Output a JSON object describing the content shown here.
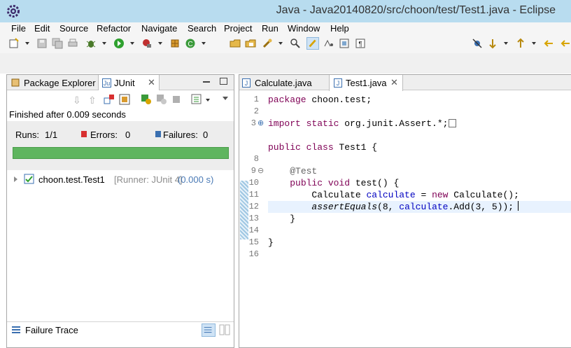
{
  "window": {
    "title": "Java - Java20140820/src/choon/test/Test1.java - Eclipse"
  },
  "menu": [
    "File",
    "Edit",
    "Source",
    "Refactor",
    "Navigate",
    "Search",
    "Project",
    "Run",
    "Window",
    "Help"
  ],
  "left_panel": {
    "tabs": {
      "package_explorer": "Package Explorer",
      "junit": "JUnit"
    },
    "status": "Finished after 0.009 seconds",
    "counters": {
      "runs_label": "Runs:",
      "runs_value": "1/1",
      "errors_label": "Errors:",
      "errors_value": "0",
      "failures_label": "Failures:",
      "failures_value": "0"
    },
    "progress": {
      "fraction": 1.0,
      "color": "#5fb55f"
    },
    "tree": {
      "name": "choon.test.Test1",
      "runner": "[Runner: JUnit 4]",
      "time": "(0.000 s)"
    },
    "failure_trace": "Failure Trace"
  },
  "editor": {
    "tabs": {
      "calculate": "Calculate.java",
      "test1": "Test1.java"
    },
    "line_numbers": [
      "1",
      "2",
      "3",
      "8",
      "9",
      "10",
      "11",
      "12",
      "13",
      "14",
      "15",
      "16"
    ],
    "code": {
      "l1_kw": "package",
      "l1_rest": " choon.test;",
      "l3_kw": "import static",
      "l3_rest": " org.junit.Assert.*;",
      "l5_kw": "public class",
      "l5_rest": " Test1 {",
      "l9_ann": "@Test",
      "l10_kw": "public void",
      "l10_rest": " test() {",
      "l11_type": "Calculate ",
      "l11_var": "calculate",
      "l11_eq": " = ",
      "l11_new": "new",
      "l11_rest": " Calculate();",
      "l12_call": "assertEquals",
      "l12_open": "(8, ",
      "l12_var": "calculate",
      "l12_rest": ".Add(3, 5));",
      "l13": "}",
      "l15": "}"
    }
  },
  "colors": {
    "keyword": "#7f0055",
    "field": "#0000c0",
    "annotation": "#646464",
    "success": "#5fb55f",
    "titlebar": "#b8dcef"
  }
}
